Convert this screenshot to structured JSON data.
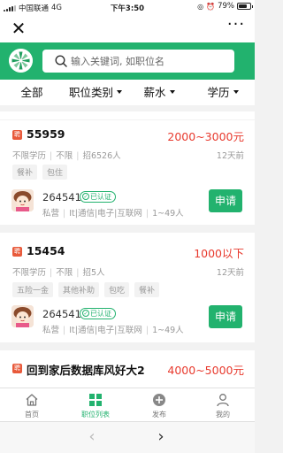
{
  "status_bar": {
    "carrier": "中国联通",
    "network": "4G",
    "time": "下午3:50",
    "battery": "79%",
    "battery_level": 0.79
  },
  "search": {
    "placeholder": "输入关键词, 如职位名"
  },
  "filters": [
    {
      "label": "全部"
    },
    {
      "label": "职位类别"
    },
    {
      "label": "薪水"
    },
    {
      "label": "学历"
    }
  ],
  "jobs": [
    {
      "badge": "聘",
      "title": "55959",
      "salary": "2000~3000元",
      "education": "不限学历",
      "experience": "不限",
      "headcount": "招6526人",
      "posted": "12天前",
      "perks": [
        "餐补",
        "包住"
      ],
      "company": "264541",
      "verified": "已认证",
      "ownership": "私营",
      "industry": "It|通信|电子|互联网",
      "size": "1~49人",
      "apply_label": "申请"
    },
    {
      "badge": "聘",
      "title": "15454",
      "salary": "1000以下",
      "education": "不限学历",
      "experience": "不限",
      "headcount": "招5人",
      "posted": "12天前",
      "perks": [
        "五险一金",
        "其他补助",
        "包吃",
        "餐补"
      ],
      "company": "264541",
      "verified": "已认证",
      "ownership": "私营",
      "industry": "It|通信|电子|互联网",
      "size": "1~49人",
      "apply_label": "申请"
    },
    {
      "badge": "聘",
      "title": "回到家后数据库风好大2",
      "salary": "4000~5000元"
    }
  ],
  "tabbar": [
    {
      "label": "首页",
      "icon": "home-icon"
    },
    {
      "label": "职位列表",
      "icon": "grid-icon",
      "active": true
    },
    {
      "label": "发布",
      "icon": "plus-circle-icon"
    },
    {
      "label": "我的",
      "icon": "user-icon"
    }
  ],
  "colors": {
    "brand_green": "#22b26e",
    "salary_red": "#e83a2e",
    "badge_orange": "#e85a3b"
  }
}
